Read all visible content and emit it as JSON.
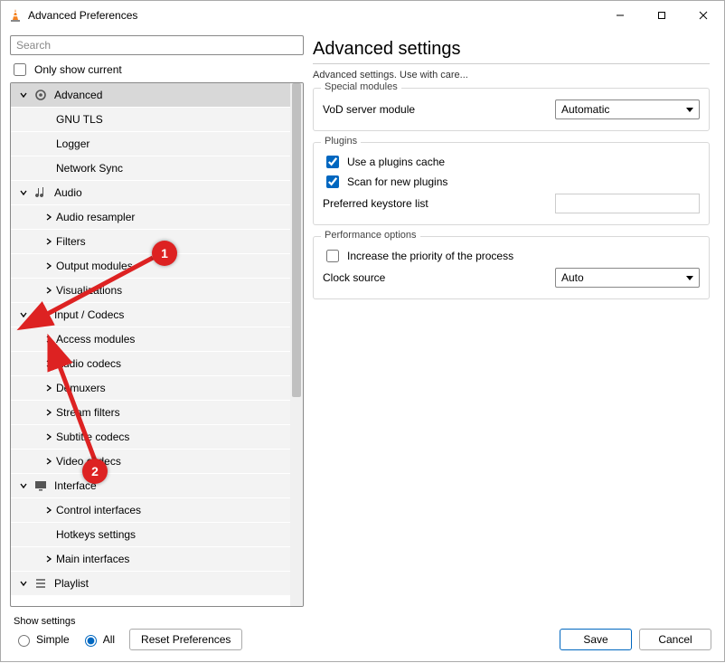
{
  "window": {
    "title": "Advanced Preferences"
  },
  "search": {
    "placeholder": "Search"
  },
  "only_show_current": {
    "label": "Only show current",
    "checked": false
  },
  "tree": {
    "items": [
      {
        "label": "Advanced",
        "expanded": true,
        "icon": "gear",
        "selectedRow": true,
        "indent": 0
      },
      {
        "label": "GNU TLS",
        "expanded": null,
        "icon": null,
        "indent": 1
      },
      {
        "label": "Logger",
        "expanded": null,
        "icon": null,
        "indent": 1
      },
      {
        "label": "Network Sync",
        "expanded": null,
        "icon": null,
        "indent": 1
      },
      {
        "label": "Audio",
        "expanded": true,
        "icon": "audio",
        "indent": 0
      },
      {
        "label": "Audio resampler",
        "expanded": false,
        "icon": null,
        "indent": 1
      },
      {
        "label": "Filters",
        "expanded": false,
        "icon": null,
        "indent": 1
      },
      {
        "label": "Output modules",
        "expanded": false,
        "icon": null,
        "indent": 1
      },
      {
        "label": "Visualizations",
        "expanded": false,
        "icon": null,
        "indent": 1
      },
      {
        "label": "Input / Codecs",
        "expanded": true,
        "icon": "codecs",
        "indent": 0
      },
      {
        "label": "Access modules",
        "expanded": false,
        "icon": null,
        "indent": 1
      },
      {
        "label": "Audio codecs",
        "expanded": false,
        "icon": null,
        "indent": 1
      },
      {
        "label": "Demuxers",
        "expanded": false,
        "icon": null,
        "indent": 1
      },
      {
        "label": "Stream filters",
        "expanded": false,
        "icon": null,
        "indent": 1
      },
      {
        "label": "Subtitle codecs",
        "expanded": false,
        "icon": null,
        "indent": 1
      },
      {
        "label": "Video codecs",
        "expanded": false,
        "icon": null,
        "indent": 1
      },
      {
        "label": "Interface",
        "expanded": true,
        "icon": "interface",
        "indent": 0
      },
      {
        "label": "Control interfaces",
        "expanded": false,
        "icon": null,
        "indent": 1
      },
      {
        "label": "Hotkeys settings",
        "expanded": null,
        "icon": null,
        "indent": 1
      },
      {
        "label": "Main interfaces",
        "expanded": false,
        "icon": null,
        "indent": 1
      },
      {
        "label": "Playlist",
        "expanded": true,
        "icon": "playlist",
        "indent": 0
      }
    ]
  },
  "heading": "Advanced settings",
  "description": "Advanced settings. Use with care...",
  "groups": {
    "special": {
      "legend": "Special modules",
      "vod": {
        "label": "VoD server module",
        "value": "Automatic"
      }
    },
    "plugins": {
      "legend": "Plugins",
      "use_cache": {
        "label": "Use a plugins cache",
        "checked": true
      },
      "scan_new": {
        "label": "Scan for new plugins",
        "checked": true
      },
      "keystore": {
        "label": "Preferred keystore list",
        "value": ""
      }
    },
    "perf": {
      "legend": "Performance options",
      "priority": {
        "label": "Increase the priority of the process",
        "checked": false
      },
      "clock": {
        "label": "Clock source",
        "value": "Auto"
      }
    }
  },
  "footer": {
    "show_settings_label": "Show settings",
    "radio_simple": "Simple",
    "radio_all": "All",
    "reset": "Reset Preferences",
    "save": "Save",
    "cancel": "Cancel"
  },
  "annotations": {
    "badge1": "1",
    "badge2": "2"
  }
}
